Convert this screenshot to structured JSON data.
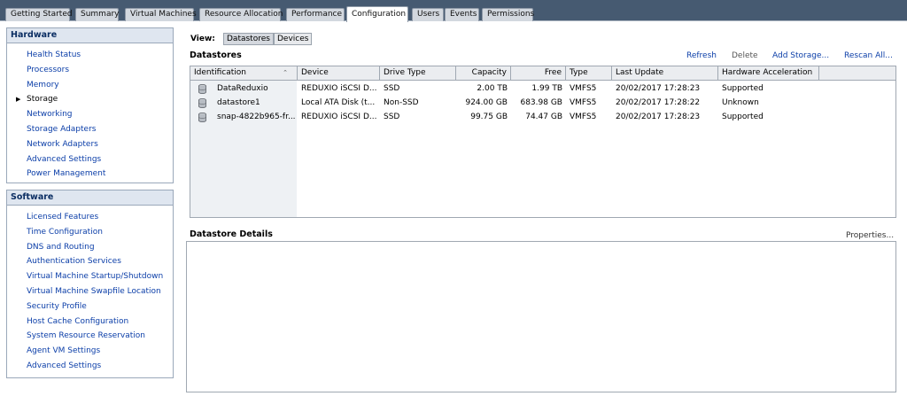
{
  "tabs": [
    {
      "label": "Getting Started",
      "active": false
    },
    {
      "label": "Summary",
      "active": false
    },
    {
      "label": "Virtual Machines",
      "active": false
    },
    {
      "label": "Resource Allocation",
      "active": false
    },
    {
      "label": "Performance",
      "active": false
    },
    {
      "label": "Configuration",
      "active": true
    },
    {
      "label": "Users",
      "active": false
    },
    {
      "label": "Events",
      "active": false
    },
    {
      "label": "Permissions",
      "active": false
    }
  ],
  "hardware": {
    "title": "Hardware",
    "items": [
      {
        "label": "Health Status"
      },
      {
        "label": "Processors"
      },
      {
        "label": "Memory"
      },
      {
        "label": "Storage",
        "current": true
      },
      {
        "label": "Networking"
      },
      {
        "label": "Storage Adapters"
      },
      {
        "label": "Network Adapters"
      },
      {
        "label": "Advanced Settings"
      },
      {
        "label": "Power Management"
      }
    ]
  },
  "software": {
    "title": "Software",
    "items": [
      {
        "label": "Licensed Features"
      },
      {
        "label": "Time Configuration"
      },
      {
        "label": "DNS and Routing"
      },
      {
        "label": "Authentication Services"
      },
      {
        "label": "Virtual Machine Startup/Shutdown"
      },
      {
        "label": "Virtual Machine Swapfile Location"
      },
      {
        "label": "Security Profile"
      },
      {
        "label": "Host Cache Configuration"
      },
      {
        "label": "System Resource Reservation"
      },
      {
        "label": "Agent VM Settings"
      },
      {
        "label": "Advanced Settings"
      }
    ]
  },
  "view": {
    "label": "View:",
    "datastores_btn": "Datastores",
    "devices_btn": "Devices"
  },
  "datastores": {
    "title": "Datastores",
    "actions": {
      "refresh": "Refresh",
      "delete": "Delete",
      "add_storage": "Add Storage...",
      "rescan": "Rescan All..."
    },
    "columns": [
      "Identification",
      "Device",
      "Drive Type",
      "Capacity",
      "Free",
      "Type",
      "Last Update",
      "Hardware Acceleration"
    ],
    "rows": [
      {
        "identification": "DataReduxio",
        "device": "REDUXIO iSCSI D...",
        "drive_type": "SSD",
        "capacity": "2.00 TB",
        "free": "1.99 TB",
        "type": "VMFS5",
        "last_update": "20/02/2017 17:28:23",
        "hw_accel": "Supported"
      },
      {
        "identification": "datastore1",
        "device": "Local ATA Disk (t...",
        "drive_type": "Non-SSD",
        "capacity": "924.00 GB",
        "free": "683.98 GB",
        "type": "VMFS5",
        "last_update": "20/02/2017 17:28:22",
        "hw_accel": "Unknown"
      },
      {
        "identification": "snap-4822b965-fr...",
        "device": "REDUXIO iSCSI D...",
        "drive_type": "SSD",
        "capacity": "99.75 GB",
        "free": "74.47 GB",
        "type": "VMFS5",
        "last_update": "20/02/2017 17:28:23",
        "hw_accel": "Supported"
      }
    ]
  },
  "details": {
    "title": "Datastore Details",
    "properties": "Properties..."
  },
  "colors": {
    "tabbar_bg": "#465a71",
    "link": "#0b3ea8",
    "panel_header_text": "#0b2e63"
  }
}
